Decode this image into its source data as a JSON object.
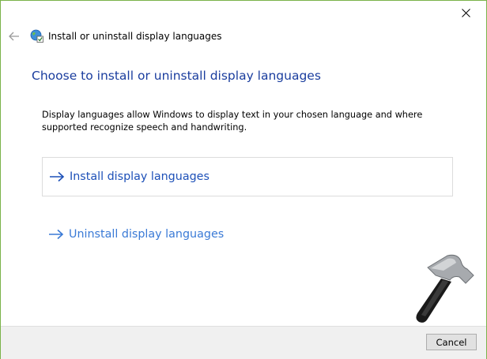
{
  "window": {
    "close_icon": "close-icon",
    "frame_color": "#7ab34a"
  },
  "header": {
    "back_icon": "back-arrow-icon",
    "app_icon": "language-globe-icon",
    "title": "Install or uninstall display languages"
  },
  "main": {
    "heading": "Choose to install or uninstall display languages",
    "description": "Display languages allow Windows to display text in your chosen language and where supported recognize speech and handwriting.",
    "options": [
      {
        "label": "Install display languages",
        "icon": "right-arrow-icon",
        "focused": true
      },
      {
        "label": "Uninstall display languages",
        "icon": "right-arrow-icon",
        "focused": false
      }
    ]
  },
  "footer": {
    "cancel_label": "Cancel"
  },
  "colors": {
    "heading": "#1a3d9e",
    "link": "#1d50b8",
    "footer_bg": "#f0f0f0"
  }
}
